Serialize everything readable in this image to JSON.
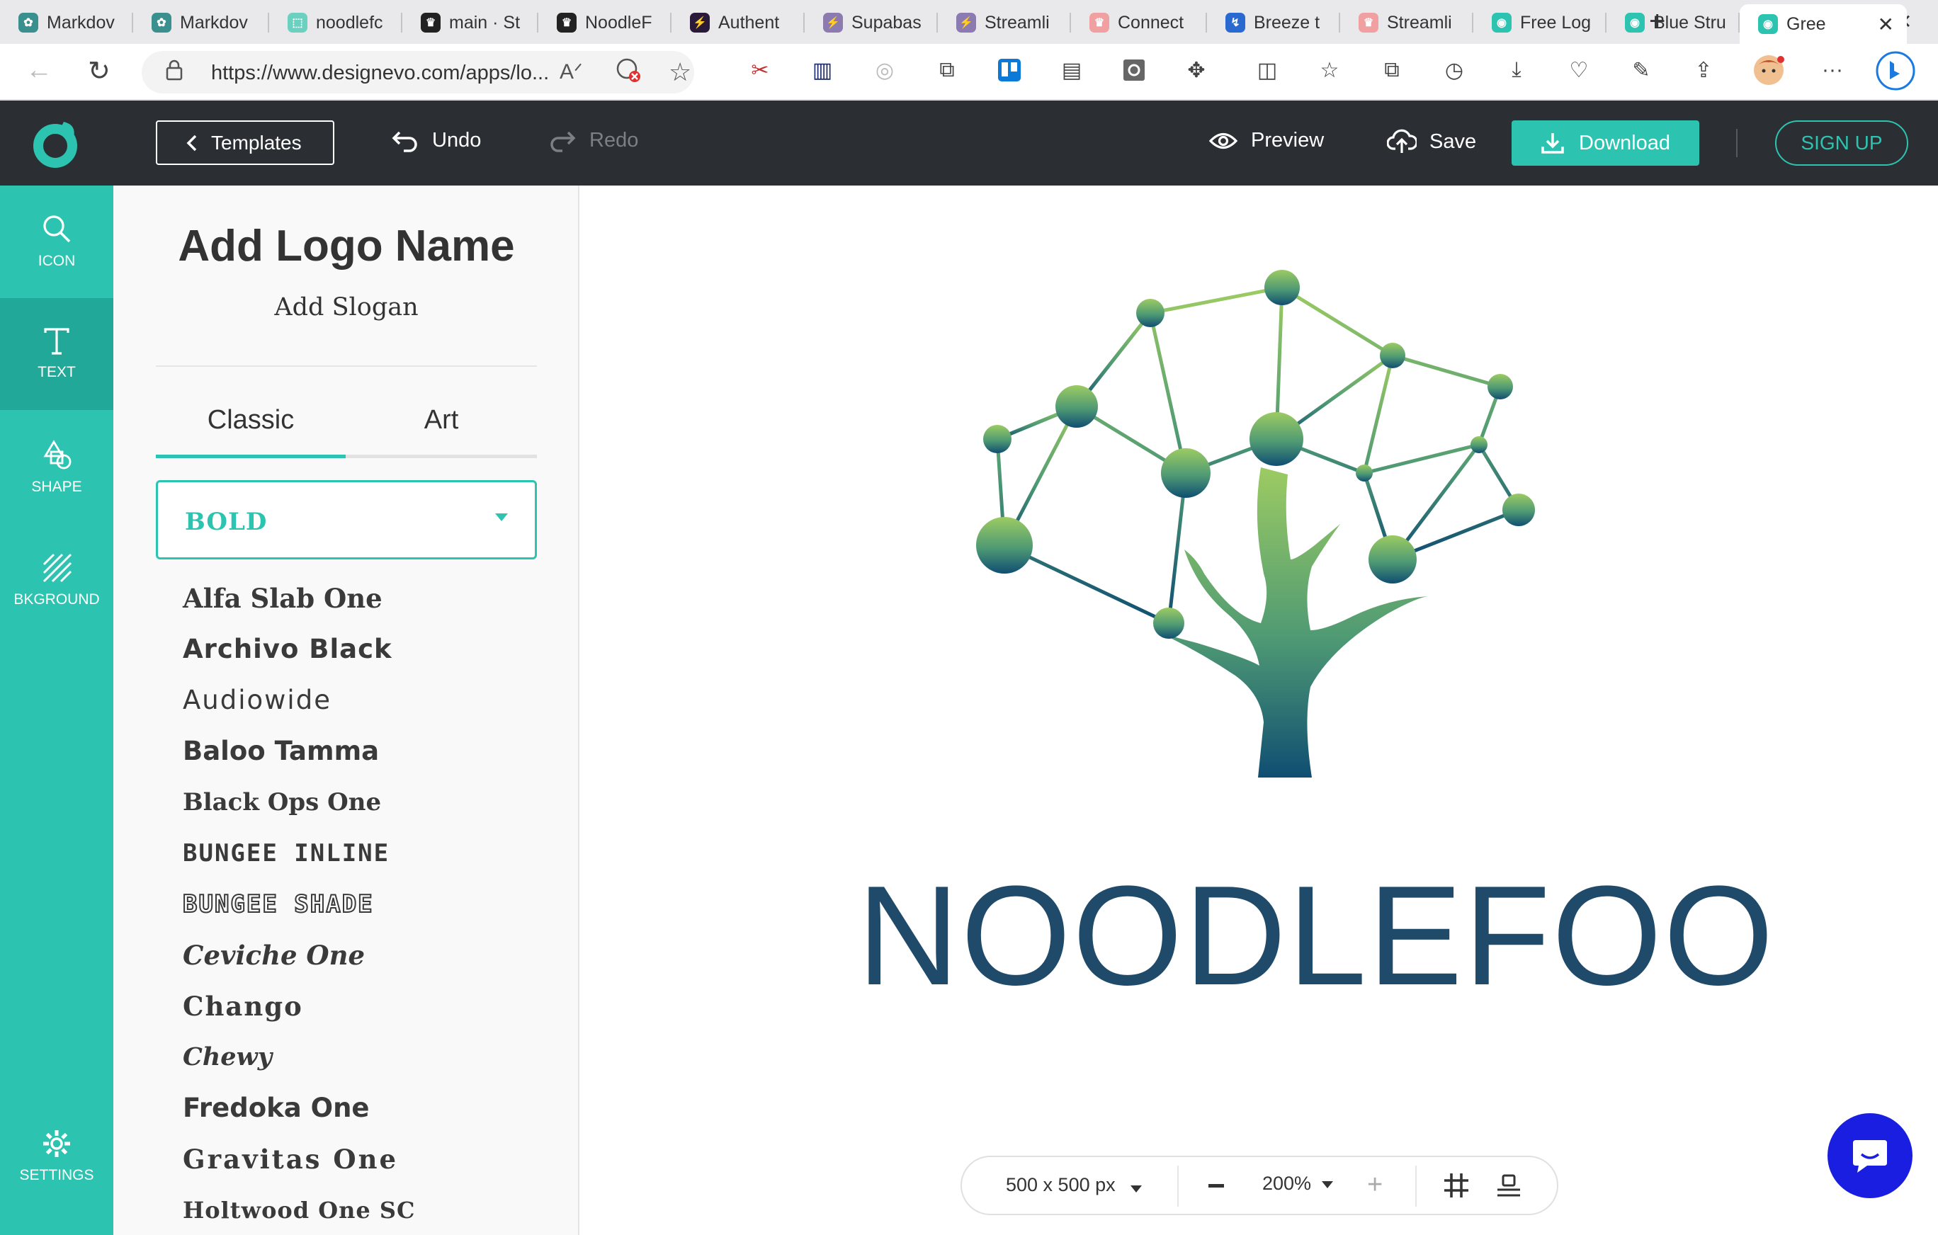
{
  "browser": {
    "tabs": [
      {
        "title": "Markdov",
        "fav_color": "#3a8f8f",
        "fav_glyph": "✿"
      },
      {
        "title": "Markdov",
        "fav_color": "#3a8f8f",
        "fav_glyph": "✿"
      },
      {
        "title": "noodlefc",
        "fav_color": "#6ad0c0",
        "fav_glyph": "⬚"
      },
      {
        "title": "main · St",
        "fav_color": "#222222",
        "fav_glyph": "♛"
      },
      {
        "title": "NoodleF",
        "fav_color": "#222222",
        "fav_glyph": "♛"
      },
      {
        "title": "Authent",
        "fav_color": "#2a1a3a",
        "fav_glyph": "⚡"
      },
      {
        "title": "Supabas",
        "fav_color": "#8b7bb0",
        "fav_glyph": "⚡"
      },
      {
        "title": "Streamli",
        "fav_color": "#8b7bb0",
        "fav_glyph": "⚡"
      },
      {
        "title": "Connect",
        "fav_color": "#f0a0a0",
        "fav_glyph": "♛"
      },
      {
        "title": "Breeze t",
        "fav_color": "#2a6ad0",
        "fav_glyph": "↯"
      },
      {
        "title": "Streamli",
        "fav_color": "#f0a0a0",
        "fav_glyph": "♛"
      },
      {
        "title": "Free Log",
        "fav_color": "#2cc4b0",
        "fav_glyph": "◉"
      },
      {
        "title": "Blue Stru",
        "fav_color": "#2cc4b0",
        "fav_glyph": "◉"
      },
      {
        "title": "Gree",
        "fav_color": "#2cc4b0",
        "fav_glyph": "◉"
      }
    ],
    "url": "https://www.designevo.com/apps/lo...",
    "reader_glyph": "A ᐟ"
  },
  "header": {
    "templates_label": "Templates",
    "undo_label": "Undo",
    "redo_label": "Redo",
    "preview_label": "Preview",
    "save_label": "Save",
    "download_label": "Download",
    "signup_label": "SIGN UP"
  },
  "rail": {
    "icon_label": "ICON",
    "text_label": "TEXT",
    "shape_label": "SHAPE",
    "background_label": "BKGROUND",
    "settings_label": "SETTINGS"
  },
  "panel": {
    "logo_name": "Add Logo Name",
    "slogan": "Add Slogan",
    "tab_classic": "Classic",
    "tab_art": "Art",
    "font_category": "BOLD",
    "fonts": [
      "Alfa Slab One",
      "Archivo Black",
      "Audiowide",
      "Baloo Tamma",
      "Black Ops One",
      "BUNGEE INLINE",
      "BUNGEE SHADE",
      "Ceviche One",
      "Chango",
      "Chewy",
      "Fredoka One",
      "Gravitas One",
      "Holtwood One SC"
    ]
  },
  "canvas": {
    "wordmark": "NOODLEFOO",
    "wordmark_color": "#1f4a6a",
    "accent": "#2cc4b0"
  },
  "bottombar": {
    "size_label": "500 x 500 px",
    "zoom_label": "200%"
  }
}
